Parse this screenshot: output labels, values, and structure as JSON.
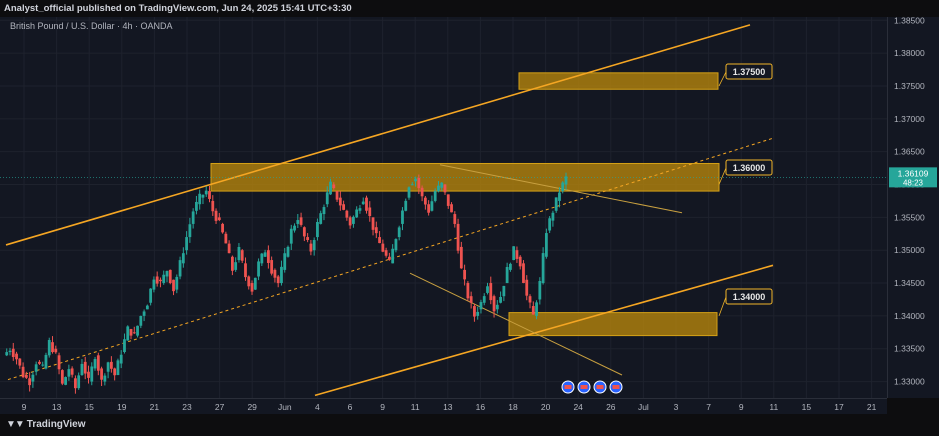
{
  "header": {
    "publisher": "Analyst_official published on TradingView.com, Jun 24, 2025 15:41 UTC+3:30"
  },
  "symbol": {
    "title": "British Pound / U.S. Dollar · 4h · OANDA"
  },
  "footer": {
    "brand": "TradingView",
    "brand_icon": "tradingview-logo-icon"
  },
  "colors": {
    "background": "#131722",
    "zone": "#b8860b",
    "channel": "#f5a623",
    "up": "#26a69a",
    "down": "#ef5350",
    "price_tag": "#26a69a",
    "label_border": "#f0b429"
  },
  "current_price": {
    "value": "1.36109",
    "countdown": "48:23"
  },
  "zone_labels": [
    {
      "price": 1.375,
      "label": "1.37500"
    },
    {
      "price": 1.36,
      "label": "1.36000"
    },
    {
      "price": 1.34,
      "label": "1.34000"
    }
  ],
  "event_icons": [
    "flag-icon",
    "flag-icon",
    "flag-icon",
    "flag-icon"
  ],
  "chart_data": {
    "type": "candlestick",
    "title": "British Pound / U.S. Dollar · 4h · OANDA",
    "ylim": [
      1.3275,
      1.3855
    ],
    "y_ticks": [
      "1.38500",
      "1.38000",
      "1.37500",
      "1.37000",
      "1.36500",
      "1.36000",
      "1.35500",
      "1.35000",
      "1.34500",
      "1.34000",
      "1.33500",
      "1.33000"
    ],
    "x_ticks": [
      "9",
      "13",
      "15",
      "19",
      "21",
      "23",
      "27",
      "29",
      "Jun",
      "4",
      "6",
      "9",
      "11",
      "13",
      "16",
      "18",
      "20",
      "24",
      "26",
      "Jul",
      "3",
      "7",
      "9",
      "11",
      "15",
      "17",
      "21"
    ],
    "grid": true,
    "zones": [
      {
        "from": 1.3745,
        "to": 1.377
      },
      {
        "from": 1.359,
        "to": 1.3632
      },
      {
        "from": 1.337,
        "to": 1.3405
      }
    ],
    "price_path": [
      [
        1.335,
        1.3335,
        1.331,
        1.33,
        1.333,
        1.332,
        1.336,
        1.334,
        1.3295,
        1.332,
        1.329,
        1.333,
        1.33,
        1.334,
        1.33,
        1.333,
        1.331,
        1.3345,
        1.338,
        1.337,
        1.34,
        1.342,
        1.346,
        1.345,
        1.347,
        1.344,
        1.348,
        1.352,
        1.356,
        1.358,
        1.359,
        1.356,
        1.354,
        1.351,
        1.347,
        1.35,
        1.346,
        1.344,
        1.348,
        1.35,
        1.347,
        1.345,
        1.349,
        1.353,
        1.355,
        1.352,
        1.35,
        1.354,
        1.357,
        1.36,
        1.358,
        1.356,
        1.354,
        1.356,
        1.358,
        1.355,
        1.352,
        1.35,
        1.348,
        1.352,
        1.356,
        1.36,
        1.361,
        1.358,
        1.356,
        1.359,
        1.36,
        1.357,
        1.354,
        1.347,
        1.343,
        1.34,
        1.342,
        1.345,
        1.341,
        1.343,
        1.347,
        1.35,
        1.348,
        1.343,
        1.34,
        1.345,
        1.353,
        1.356,
        1.359,
        1.361
      ]
    ]
  }
}
